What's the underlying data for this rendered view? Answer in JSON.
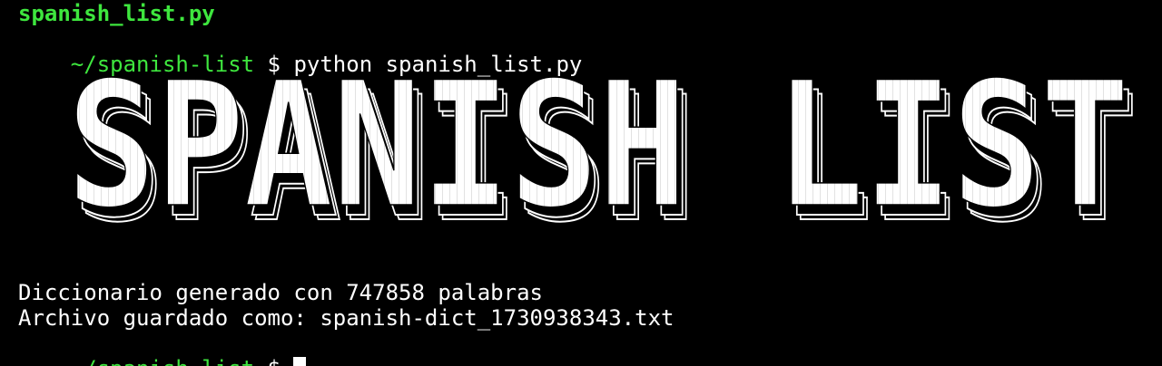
{
  "terminal": {
    "title_line": "spanish_list.py",
    "prompt_path": "~/spanish-list",
    "prompt_symbol": "$",
    "command": "python spanish_list.py",
    "banner_text": "SPANISH LIST",
    "output_lines": [
      "Diccionario generado con 747858 palabras",
      "Archivo guardado como: spanish-dict_1730938343.txt"
    ],
    "final_prompt_path": "~/spanish-list",
    "final_prompt_symbol": "$"
  },
  "colors": {
    "background": "#000000",
    "prompt": "#3ee63e",
    "text": "#ffffff"
  }
}
